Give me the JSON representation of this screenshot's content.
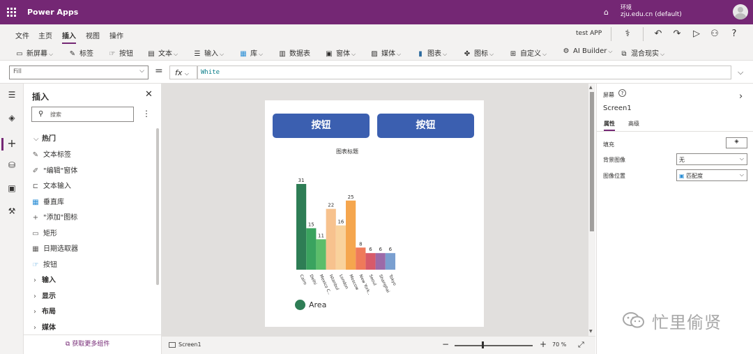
{
  "titlebar": {
    "app_name": "Power Apps",
    "env_label": "环境",
    "env_value": "zju.edu.cn (default)"
  },
  "menu": {
    "items": [
      "文件",
      "主页",
      "插入",
      "视图",
      "操作"
    ],
    "active": "插入",
    "app_title": "test APP"
  },
  "toolbar": {
    "items": [
      "新屏幕",
      "标签",
      "按钮",
      "文本",
      "输入",
      "库",
      "数据表",
      "窗体",
      "媒体",
      "图表",
      "图标",
      "自定义",
      "AI Builder",
      "混合现实"
    ]
  },
  "formula": {
    "property": "Fill",
    "equals": "=",
    "fx": "fx",
    "value": "White"
  },
  "insert_panel": {
    "title": "插入",
    "search_placeholder": "搜索",
    "popular_heading": "热门",
    "items": [
      "文本标签",
      "\"编辑\"窗体",
      "文本输入",
      "垂直库",
      "\"添加\"图标",
      "矩形",
      "日期选取器",
      "按钮"
    ],
    "sections": [
      "输入",
      "显示",
      "布局",
      "媒体"
    ],
    "get_more": "获取更多组件"
  },
  "screen": {
    "button1": "按钮",
    "button2": "按钮",
    "chart_title": "图表标题",
    "legend": "Area"
  },
  "chart_data": {
    "type": "bar",
    "title": "图表标题",
    "categories": [
      "Cairo",
      "Delhi",
      "Mexico C..",
      "Istanbul",
      "London",
      "Moscow",
      "New York..",
      "Seoul",
      "Shanghai",
      "Tokyo"
    ],
    "series": [
      {
        "name": "Area",
        "values": [
          31,
          15,
          11,
          22,
          16,
          25,
          8,
          6,
          6,
          6
        ]
      }
    ],
    "colors": [
      "#2e7d55",
      "#3aa35f",
      "#5cbd6a",
      "#f7c28e",
      "#f9d29c",
      "#f5a64e",
      "#ef7a5a",
      "#d75a6a",
      "#9c6aa8",
      "#7a9fd0"
    ],
    "ylim": [
      0,
      31
    ],
    "grid": false,
    "legend": "bottom-left"
  },
  "statusbar": {
    "screen": "Screen1",
    "zoom": "70 %"
  },
  "properties": {
    "type": "屏幕",
    "name": "Screen1",
    "tab_properties": "属性",
    "tab_advanced": "高级",
    "fill_label": "填充",
    "bg_image_label": "背景图像",
    "bg_image_value": "无",
    "image_pos_label": "图像位置",
    "image_pos_value": "匹配度"
  },
  "watermark": "忙里偷贤"
}
